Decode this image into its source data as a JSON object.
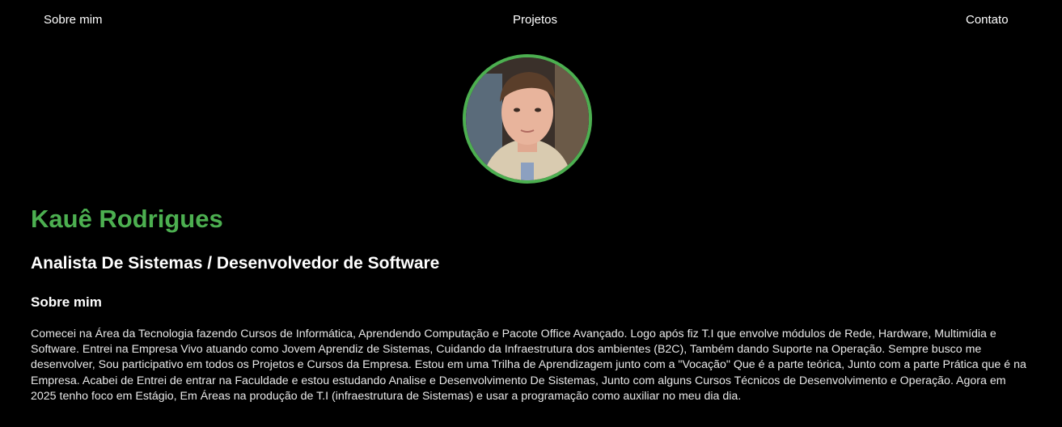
{
  "nav": {
    "about_label": "Sobre mim",
    "projects_label": "Projetos",
    "contact_label": "Contato"
  },
  "profile": {
    "name": "Kauê Rodrigues",
    "role": "Analista De Sistemas / Desenvolvedor de Software",
    "accent_color": "#4caf50"
  },
  "about": {
    "title": "Sobre mim",
    "text": "Comecei na Área da Tecnologia fazendo Cursos de Informática, Aprendendo Computação e Pacote Office Avançado. Logo após fiz T.I que envolve módulos de Rede, Hardware, Multimídia e Software. Entrei na Empresa Vivo atuando como Jovem Aprendiz de Sistemas, Cuidando da Infraestrutura dos ambientes (B2C), Também dando Suporte na Operação. Sempre busco me desenvolver, Sou participativo em todos os Projetos e Cursos da Empresa. Estou em uma Trilha de Aprendizagem junto com a \"Vocação\" Que é a parte teórica, Junto com a parte Prática que é na Empresa. Acabei de Entrei de entrar na Faculdade e estou estudando Analise e Desenvolvimento De Sistemas, Junto com alguns Cursos Técnicos de Desenvolvimento e Operação. Agora em 2025 tenho foco em Estágio, Em Áreas na produção de T.I (infraestrutura de Sistemas) e usar a programação como auxiliar no meu dia dia."
  }
}
